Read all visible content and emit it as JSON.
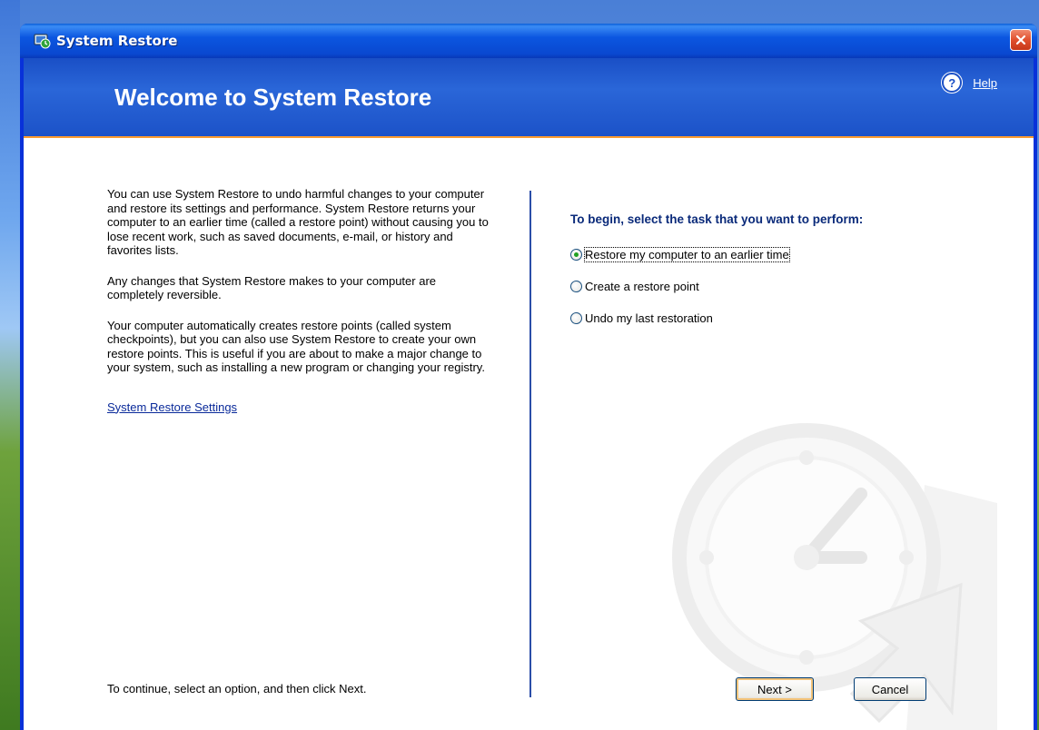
{
  "window": {
    "title": "System Restore"
  },
  "header": {
    "title": "Welcome to System Restore",
    "help_label": "Help",
    "help_icon_glyph": "?"
  },
  "left": {
    "paragraphs": [
      "You can use System Restore to undo harmful changes to your computer and restore its settings and performance. System Restore returns your computer to an earlier time (called a restore point) without causing you to lose recent work, such as saved documents, e-mail, or history and favorites lists.",
      "Any changes that System Restore makes to your computer are completely reversible.",
      "Your computer automatically creates restore points (called system checkpoints), but you can also use System Restore to create your own restore points. This is useful if you are about to make a major change to your system, such as installing a new program or changing your registry."
    ],
    "settings_link": "System Restore Settings"
  },
  "right": {
    "heading": "To begin, select the task that you want to perform:",
    "options": [
      {
        "label": "Restore my computer to an earlier time",
        "checked": true
      },
      {
        "label": "Create a restore point",
        "checked": false
      },
      {
        "label": "Undo my last restoration",
        "checked": false
      }
    ]
  },
  "footer": {
    "instruction": "To continue, select an option, and then click Next.",
    "next_label": "Next >",
    "cancel_label": "Cancel"
  },
  "colors": {
    "header_band": "#1a4fc6",
    "accent_orange": "#ff9b2f",
    "heading_text": "#0a2a7a",
    "link": "#0a2a9a"
  }
}
